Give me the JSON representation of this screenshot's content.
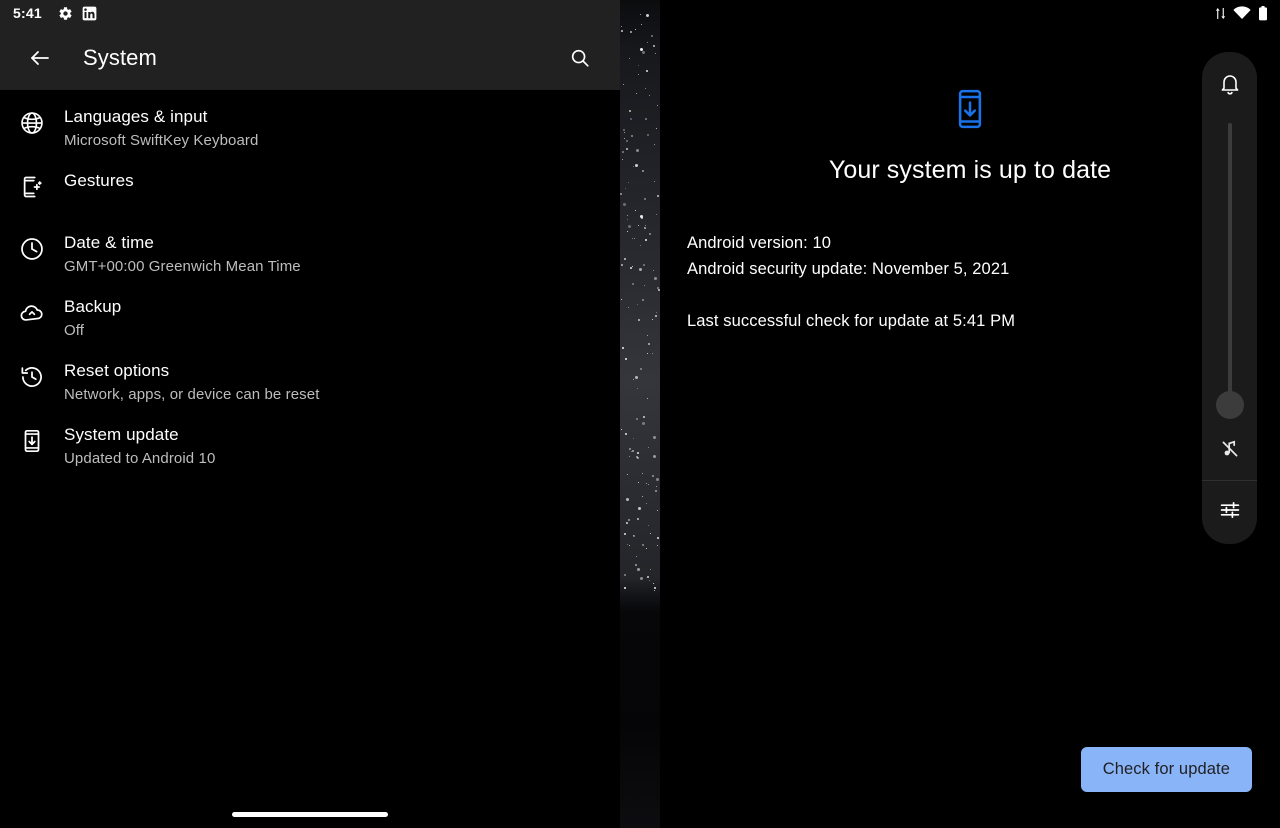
{
  "status_bar_left": {
    "time": "5:41",
    "icons": [
      "settings-gear-icon",
      "linkedin-app-icon"
    ]
  },
  "status_bar_right": {
    "icons": [
      "data-transfer-icon",
      "wifi-signal-4-icon",
      "battery-full-icon"
    ]
  },
  "left_pane": {
    "app_bar": {
      "back_label": "back-arrow-icon",
      "title": "System",
      "search_label": "search-icon"
    },
    "items": [
      {
        "icon": "globe-icon",
        "title": "Languages & input",
        "subtitle": "Microsoft SwiftKey Keyboard"
      },
      {
        "icon": "gestures-phone-sparkle-icon",
        "title": "Gestures",
        "subtitle": ""
      },
      {
        "icon": "clock-icon",
        "title": "Date & time",
        "subtitle": "GMT+00:00 Greenwich Mean Time"
      },
      {
        "icon": "cloud-upload-icon",
        "title": "Backup",
        "subtitle": "Off"
      },
      {
        "icon": "history-restore-icon",
        "title": "Reset options",
        "subtitle": "Network, apps, or device can be reset"
      },
      {
        "icon": "phone-download-icon",
        "title": "System update",
        "subtitle": "Updated to Android 10"
      }
    ]
  },
  "right_pane": {
    "hero_icon": "phone-download-blue-icon",
    "heading": "Your system is up to date",
    "details": [
      "Android version: 10",
      "Android security update: November 5, 2021"
    ],
    "last_check": "Last successful check for update at 5:41 PM",
    "cta_label": "Check for update"
  },
  "volume_panel": {
    "top_icon": "bell-ring-icon",
    "mute_icon": "music-note-off-icon",
    "settings_icon": "audio-sliders-icon",
    "slider_value_label": "low"
  },
  "colors": {
    "accent_blue": "#8ab4f8",
    "hero_blue": "#1a73e8",
    "surface": "#212121",
    "panel": "#1b1b1b",
    "background": "#000000",
    "secondary_text": "#bdbdbd"
  }
}
